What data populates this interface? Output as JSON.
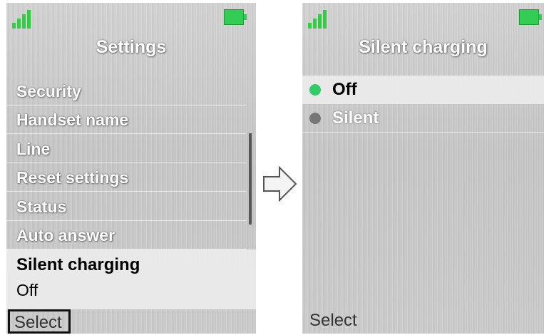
{
  "left_screen": {
    "title": "Settings",
    "menu_items": [
      "Security",
      "Handset name",
      "Line",
      "Reset settings",
      "Status",
      "Auto answer"
    ],
    "selected_item": {
      "label": "Silent charging",
      "value": "Off"
    },
    "softkey": "Select"
  },
  "right_screen": {
    "title": "Silent charging",
    "options": [
      {
        "label": "Off",
        "selected": true
      },
      {
        "label": "Silent",
        "selected": false
      }
    ],
    "softkey": "Select"
  },
  "colors": {
    "accent_green": "#33cc44",
    "radio_selected": "#33cc66",
    "radio_unselected": "#777777"
  },
  "icons": [
    "signal-strength-icon",
    "battery-icon",
    "arrow-right-icon"
  ]
}
